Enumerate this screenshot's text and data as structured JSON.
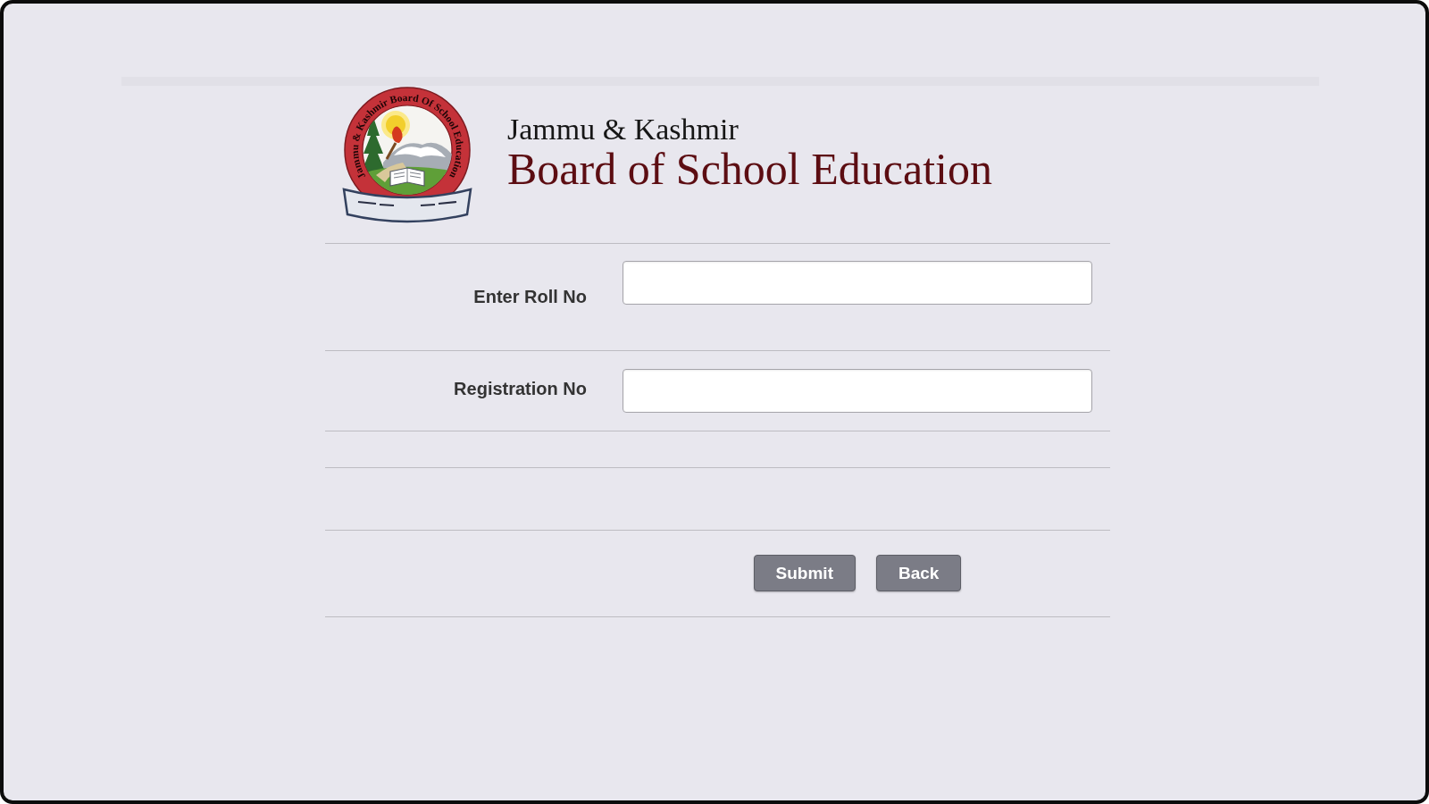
{
  "header": {
    "emblem_text": "Jammu & Kashmir Board Of School Education",
    "subtitle": "Jammu & Kashmir",
    "title": "Board of School Education"
  },
  "form": {
    "fields": [
      {
        "label": "Enter Roll No"
      },
      {
        "label": "Registration No"
      }
    ]
  },
  "buttons": [
    "Submit",
    "Back"
  ]
}
